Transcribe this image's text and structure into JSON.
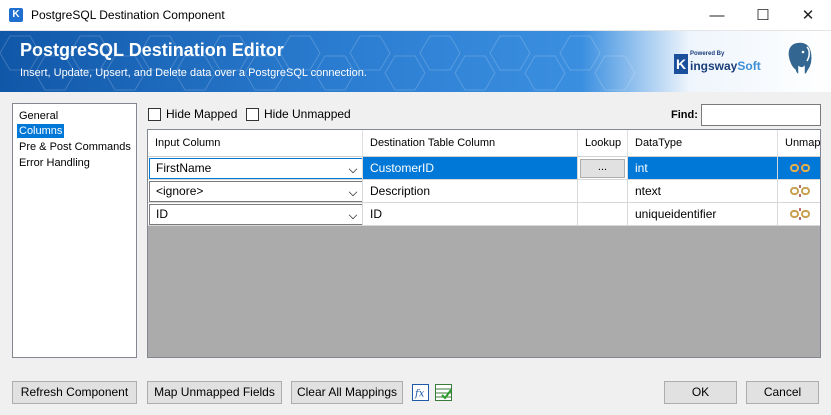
{
  "window": {
    "title": "PostgreSQL Destination Component",
    "app_icon_letter": "K",
    "minimize": "—",
    "maximize": "☐",
    "close": "✕"
  },
  "banner": {
    "title": "PostgreSQL Destination Editor",
    "subtitle": "Insert, Update, Upsert, and Delete data over a PostgreSQL connection.",
    "brand_powered": "Powered By",
    "brand_k": "K",
    "brand_name": "ingsway",
    "brand_soft": "Soft"
  },
  "nav": {
    "items": [
      {
        "label": "General"
      },
      {
        "label": "Columns"
      },
      {
        "label": "Pre & Post Commands"
      },
      {
        "label": "Error Handling"
      }
    ]
  },
  "filters": {
    "hide_mapped": "Hide Mapped",
    "hide_unmapped": "Hide Unmapped",
    "find_label": "Find:",
    "find_value": ""
  },
  "grid": {
    "columns": [
      "Input Column",
      "Destination Table Column",
      "Lookup",
      "DataType",
      "Unmap"
    ],
    "lookup_button": "...",
    "rows": [
      {
        "input": "FirstName",
        "destination": "CustomerID",
        "datatype": "int"
      },
      {
        "input": "<ignore>",
        "destination": "Description",
        "datatype": "ntext"
      },
      {
        "input": "ID",
        "destination": "ID",
        "datatype": "uniqueidentifier"
      }
    ]
  },
  "buttons": {
    "refresh": "Refresh Component",
    "map_unmapped": "Map Unmapped Fields",
    "clear_all": "Clear All Mappings",
    "ok": "OK",
    "cancel": "Cancel"
  },
  "colors": {
    "accent": "#0078d7",
    "banner_dark": "#1157a8"
  }
}
